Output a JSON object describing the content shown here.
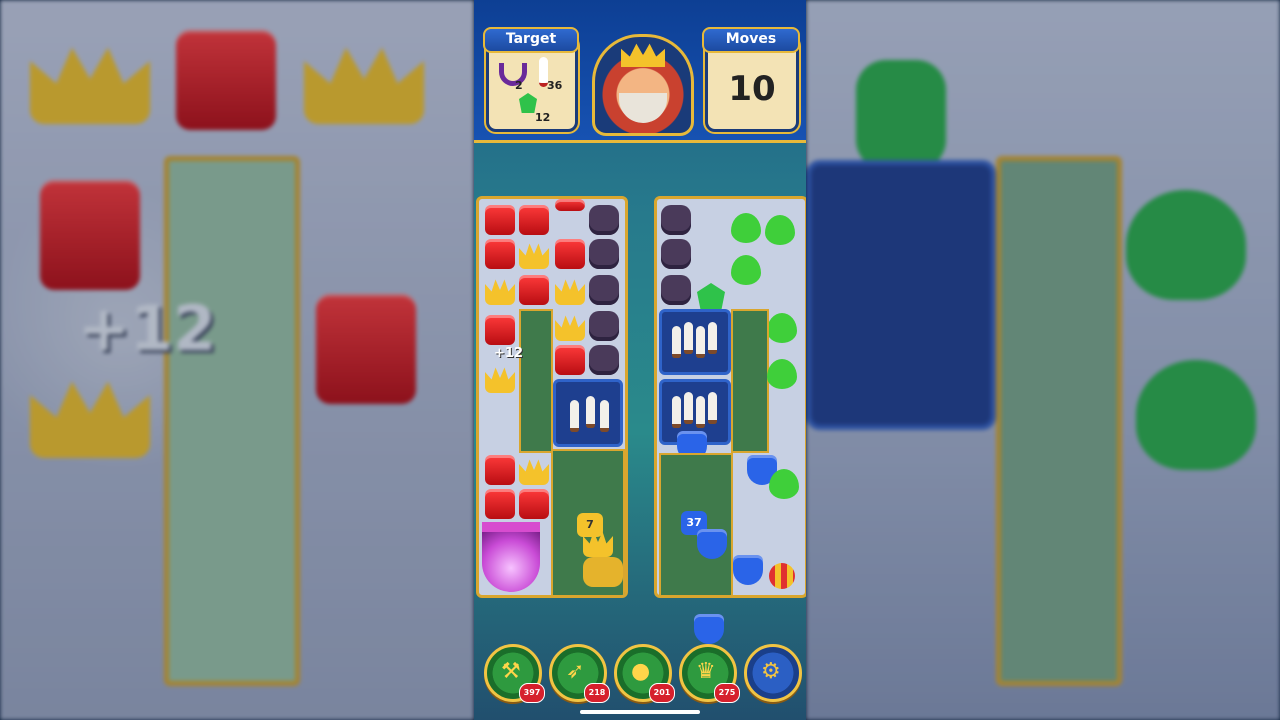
{
  "header": {
    "target_label": "Target",
    "moves_label": "Moves",
    "moves_value": "10",
    "targets": [
      {
        "icon": "magnet-icon",
        "count": "2"
      },
      {
        "icon": "bowling-pin-icon",
        "count": "36"
      },
      {
        "icon": "gem-icon",
        "count": "12"
      }
    ]
  },
  "board": {
    "score_popup": "+12",
    "background_popup": "+12",
    "counter_badge_left": "7",
    "counter_badge_right": "37"
  },
  "boosters": [
    {
      "name": "hammer-booster",
      "count": "397",
      "icon": "hammer-icon"
    },
    {
      "name": "arrow-booster",
      "count": "218",
      "icon": "arrow-icon"
    },
    {
      "name": "cannon-booster",
      "count": "201",
      "icon": "cannon-icon"
    },
    {
      "name": "jester-booster",
      "count": "275",
      "icon": "jester-hat-icon"
    }
  ],
  "colors": {
    "header_blue": "#1752b2",
    "gold_border": "#e7b93a",
    "booster_green": "#2e9a3f",
    "badge_red": "#d6202c"
  }
}
